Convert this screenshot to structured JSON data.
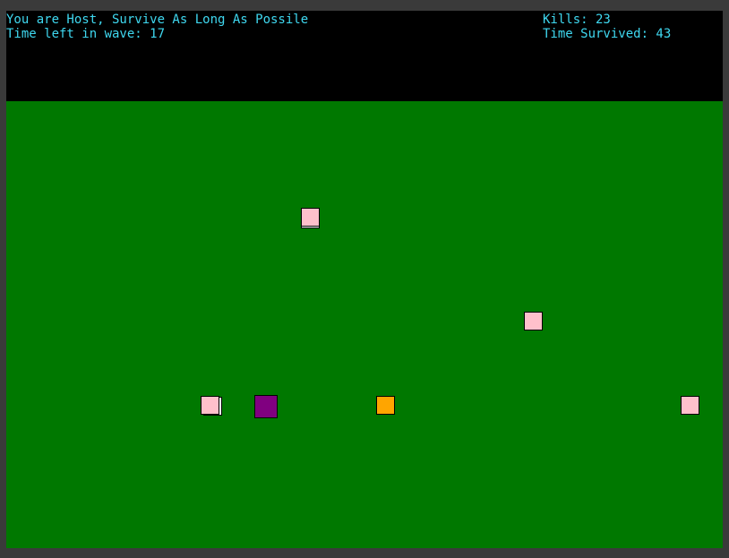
{
  "hud": {
    "host_text": "You are Host, Survive As Long As Possile",
    "wave_text": "Time left in wave: 17",
    "kills_text": "Kills: 23",
    "survived_text": "Time Survived: 43"
  },
  "colors": {
    "hud_text": "#3fd8f0",
    "hud_background": "#000000",
    "field": "#007800",
    "frame": "#3a3a3a",
    "enemy": "#ffc0cb",
    "player": "#800080",
    "pickup": "#ffa500"
  }
}
